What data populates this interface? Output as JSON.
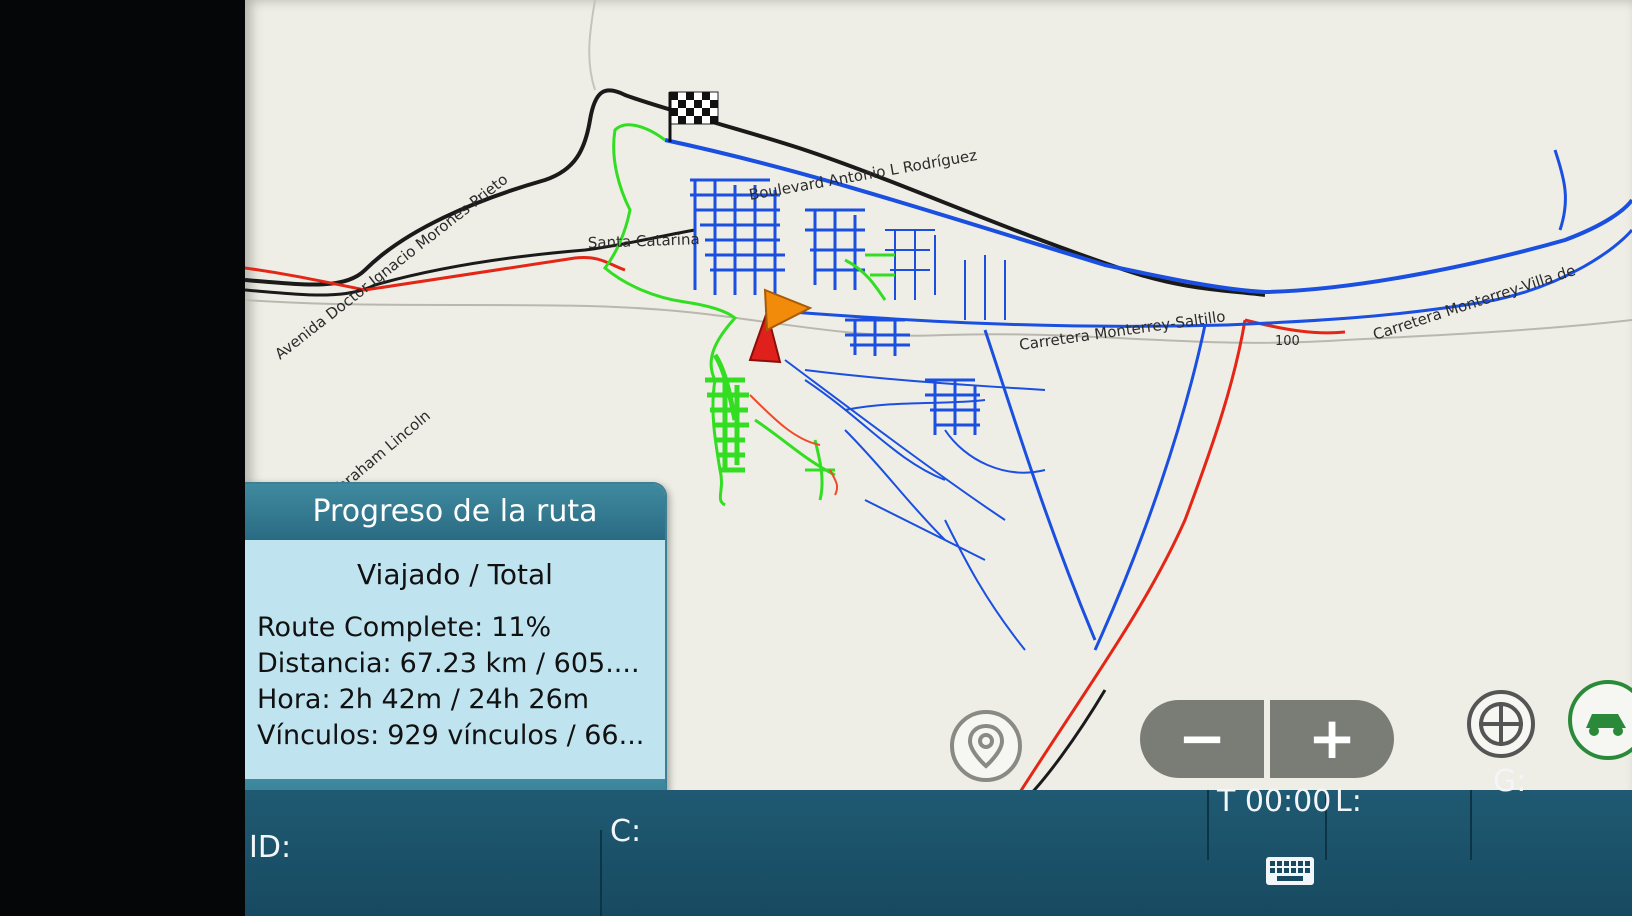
{
  "map": {
    "road_labels": [
      "Boulevard Antonio L Rodríguez",
      "Santa Catarina",
      "Avenida Doctor Ignacio Morones Prieto",
      "Carretera Monterrey-Saltillo",
      "100",
      "Carretera Monterrey-Villa de",
      "Avenida Abraham Lincoln"
    ],
    "colors": {
      "traveled_route": "#33dd22",
      "untraveled_route": "#1a4fe0",
      "highway": "#e32616",
      "road": "#1a1a1a",
      "start_marker": "#e0201a",
      "vehicle_marker": "#f28a0a"
    },
    "finish_icon": "checkered-flag-icon"
  },
  "route_progress": {
    "title": "Progreso de la ruta",
    "subtitle": "Viajado / Total",
    "stats": [
      {
        "label": "Route Complete:",
        "value": "11%"
      },
      {
        "label": "Distancia:",
        "value": "67.23 km / 605...."
      },
      {
        "label": "Hora:",
        "value": "2h 42m / 24h 26m"
      },
      {
        "label": "Vínculos:",
        "value": "929 vínculos / 66..."
      }
    ],
    "complete_fraction": 0.11
  },
  "controls": {
    "zoom_out_label": "−",
    "zoom_in_label": "+",
    "location_icon": "map-pin-icon",
    "crosshair_icon": "crosshair-icon",
    "car_icon": "car-icon"
  },
  "status_bar": {
    "time": "T 00:00",
    "l_label": "L:",
    "g_label": "G:",
    "id_label": "ID:",
    "c_label": "C:",
    "keyboard_icon": "keyboard-icon"
  }
}
